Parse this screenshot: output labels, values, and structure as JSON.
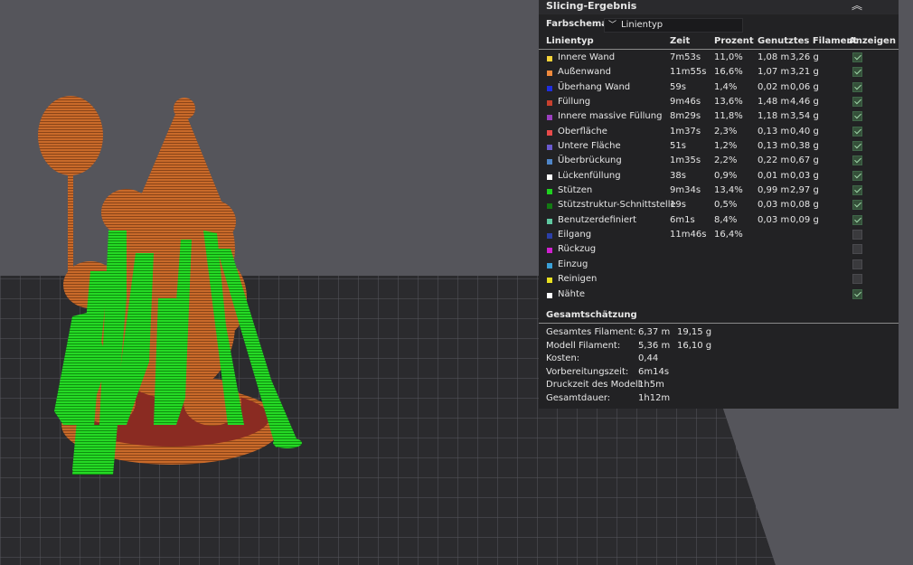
{
  "panel": {
    "title": "Slicing-Ergebnis",
    "collapse_icon": "chevron-up-double-icon",
    "scheme_label": "Farbschema",
    "scheme_value": "Linientyp",
    "columns": {
      "type": "Linientyp",
      "time": "Zeit",
      "percent": "Prozent",
      "filament": "Genutztes Filament",
      "show": "Anzeigen"
    },
    "rows": [
      {
        "label": "Innere Wand",
        "color": "#f5d33a",
        "time": "7m53s",
        "percent": "11,0%",
        "fil_m": "1,08 m",
        "fil_g": "3,26 g",
        "show": true
      },
      {
        "label": "Außenwand",
        "color": "#f08a3c",
        "time": "11m55s",
        "percent": "16,6%",
        "fil_m": "1,07 m",
        "fil_g": "3,21 g",
        "show": true
      },
      {
        "label": "Überhang Wand",
        "color": "#1f2ee0",
        "time": "59s",
        "percent": "1,4%",
        "fil_m": "0,02 m",
        "fil_g": "0,06 g",
        "show": true
      },
      {
        "label": "Füllung",
        "color": "#c8402e",
        "time": "9m46s",
        "percent": "13,6%",
        "fil_m": "1,48 m",
        "fil_g": "4,46 g",
        "show": true
      },
      {
        "label": "Innere massive Füllung",
        "color": "#9b3fc0",
        "time": "8m29s",
        "percent": "11,8%",
        "fil_m": "1,18 m",
        "fil_g": "3,54 g",
        "show": true
      },
      {
        "label": "Oberfläche",
        "color": "#e84a4a",
        "time": "1m37s",
        "percent": "2,3%",
        "fil_m": "0,13 m",
        "fil_g": "0,40 g",
        "show": true
      },
      {
        "label": "Untere Fläche",
        "color": "#6a5ad0",
        "time": "51s",
        "percent": "1,2%",
        "fil_m": "0,13 m",
        "fil_g": "0,38 g",
        "show": true
      },
      {
        "label": "Überbrückung",
        "color": "#4f86c8",
        "time": "1m35s",
        "percent": "2,2%",
        "fil_m": "0,22 m",
        "fil_g": "0,67 g",
        "show": true
      },
      {
        "label": "Lückenfüllung",
        "color": "#ffffff",
        "time": "38s",
        "percent": "0,9%",
        "fil_m": "0,01 m",
        "fil_g": "0,03 g",
        "show": true
      },
      {
        "label": "Stützen",
        "color": "#1fd11f",
        "time": "9m34s",
        "percent": "13,4%",
        "fil_m": "0,99 m",
        "fil_g": "2,97 g",
        "show": true
      },
      {
        "label": "Stützstruktur-Schnittstelle",
        "color": "#137a13",
        "time": "19s",
        "percent": "0,5%",
        "fil_m": "0,03 m",
        "fil_g": "0,08 g",
        "show": true
      },
      {
        "label": "Benutzerdefiniert",
        "color": "#5fc8a0",
        "time": "6m1s",
        "percent": "8,4%",
        "fil_m": "0,03 m",
        "fil_g": "0,09 g",
        "show": true
      },
      {
        "label": "Eilgang",
        "color": "#2b3fa8",
        "time": "11m46s",
        "percent": "16,4%",
        "fil_m": "",
        "fil_g": "",
        "show": false
      },
      {
        "label": "Rückzug",
        "color": "#d020d0",
        "time": "",
        "percent": "",
        "fil_m": "",
        "fil_g": "",
        "show": false
      },
      {
        "label": "Einzug",
        "color": "#3aa0d8",
        "time": "",
        "percent": "",
        "fil_m": "",
        "fil_g": "",
        "show": false
      },
      {
        "label": "Reinigen",
        "color": "#e8e020",
        "time": "",
        "percent": "",
        "fil_m": "",
        "fil_g": "",
        "show": false
      },
      {
        "label": "Nähte",
        "color": "#ffffff",
        "time": "",
        "percent": "",
        "fil_m": "",
        "fil_g": "",
        "show": true
      }
    ],
    "summary_title": "Gesamtschätzung",
    "summary": [
      {
        "key": "Gesamtes Filament:",
        "v1": "6,37 m",
        "v2": "19,15 g"
      },
      {
        "key": "Modell Filament:",
        "v1": "5,36 m",
        "v2": "16,10 g"
      },
      {
        "key": "Kosten:",
        "v1": "0,44",
        "v2": ""
      },
      {
        "key": "Vorbereitungszeit:",
        "v1": "6m14s",
        "v2": ""
      },
      {
        "key": "Druckzeit des Modell:",
        "v1": "1h5m",
        "v2": ""
      },
      {
        "key": "Gesamtdauer:",
        "v1": "1h12m",
        "v2": ""
      }
    ]
  },
  "viewport": {
    "background": "#55555b",
    "plate_color": "#2a2a2c",
    "grid_color": "#5a5a60",
    "model_color": "#c96a2a",
    "support_color": "#22d322"
  }
}
